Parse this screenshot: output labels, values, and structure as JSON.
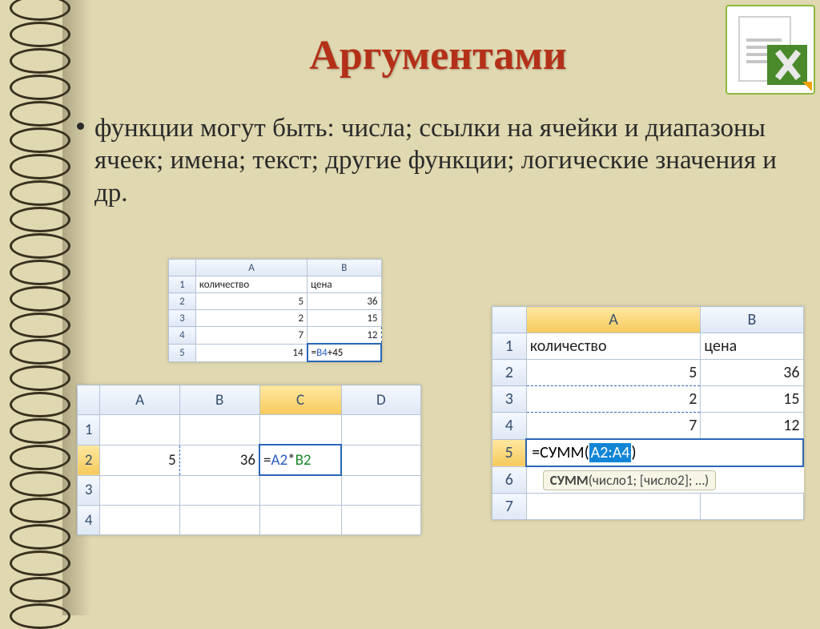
{
  "title": "Аргументами",
  "bullet": "функции могут быть: числа; ссылки на ячейки и диапазоны ячеек; имена; текст; другие функции; логические значения и др.",
  "logo_alt": "Microsoft Excel",
  "table1": {
    "cols": [
      "A",
      "B"
    ],
    "header": {
      "A": "количество",
      "B": "цена"
    },
    "rows": [
      {
        "n": "1",
        "A": "количество",
        "B": "цена"
      },
      {
        "n": "2",
        "A": "5",
        "B": "36"
      },
      {
        "n": "3",
        "A": "2",
        "B": "15"
      },
      {
        "n": "4",
        "A": "7",
        "B": "12"
      },
      {
        "n": "5",
        "A": "14",
        "B_formula_prefix": "=",
        "B_formula_ref": "B4",
        "B_formula_suffix": "+45"
      }
    ]
  },
  "table2": {
    "cols": [
      "A",
      "B",
      "C",
      "D"
    ],
    "rows": [
      {
        "n": "1",
        "A": "",
        "B": "",
        "C": "",
        "D": ""
      },
      {
        "n": "2",
        "A": "5",
        "B": "36",
        "C_prefix": "=",
        "C_refA": "A2",
        "C_star": "*",
        "C_refB": "B2",
        "D": ""
      },
      {
        "n": "3",
        "A": "",
        "B": "",
        "C": "",
        "D": ""
      },
      {
        "n": "4",
        "A": "",
        "B": "",
        "C": "",
        "D": ""
      }
    ]
  },
  "table3": {
    "cols": [
      "A",
      "B"
    ],
    "rows": [
      {
        "n": "1",
        "A": "количество",
        "B": "цена"
      },
      {
        "n": "2",
        "A": "5",
        "B": "36"
      },
      {
        "n": "3",
        "A": "2",
        "B": "15"
      },
      {
        "n": "4",
        "A": "7",
        "B": "12"
      },
      {
        "n": "5",
        "sum_prefix": "=СУММ(",
        "sum_range": "A2:A4",
        "sum_suffix": ")"
      },
      {
        "n": "6",
        "hint_fn": "СУММ",
        "hint_args": "(число1; [число2]; …)"
      },
      {
        "n": "7"
      }
    ]
  }
}
